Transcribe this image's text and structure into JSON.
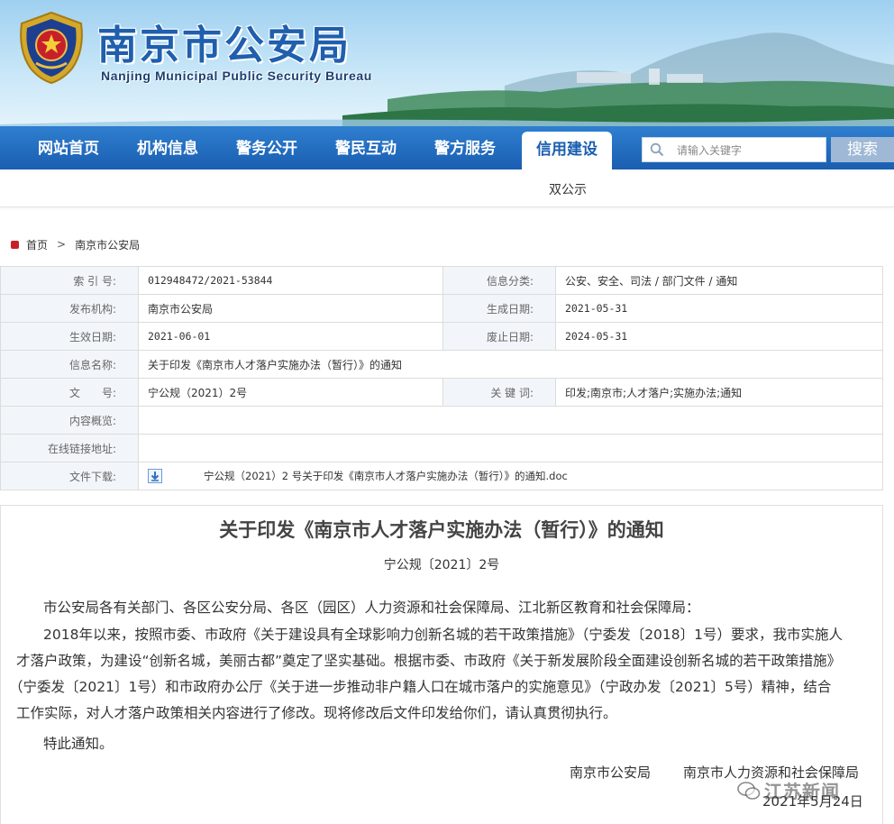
{
  "header": {
    "title": "南京市公安局",
    "subtitle": "Nanjing Municipal Public Security Bureau"
  },
  "nav": {
    "items": [
      {
        "label": "网站首页"
      },
      {
        "label": "机构信息"
      },
      {
        "label": "警务公开"
      },
      {
        "label": "警民互动"
      },
      {
        "label": "警方服务"
      },
      {
        "label": "信用建设",
        "active": true
      }
    ],
    "search": {
      "placeholder": "请输入关键字",
      "button_label": "搜索",
      "icon": "search-icon"
    },
    "sub_items": [
      {
        "label": "双公示"
      }
    ]
  },
  "breadcrumb": {
    "home": "首页",
    "current": "南京市公安局"
  },
  "info": {
    "index_label": "索 引 号:",
    "index_value": "012948472/2021-53844",
    "category_label": "信息分类:",
    "category_value": "公安、安全、司法 / 部门文件 / 通知",
    "publisher_label": "发布机构:",
    "publisher_value": "南京市公安局",
    "created_label": "生成日期:",
    "created_value": "2021-05-31",
    "effective_label": "生效日期:",
    "effective_value": "2021-06-01",
    "expire_label": "废止日期:",
    "expire_value": "2024-05-31",
    "name_label": "信息名称:",
    "name_value": "关于印发《南京市人才落户实施办法（暂行）》的通知",
    "docno_label": "文　　号:",
    "docno_value": "宁公规（2021）2号",
    "keywords_label": "关 键 词:",
    "keywords_value": "印发;南京市;人才落户;实施办法;通知",
    "summary_label": "内容概览:",
    "summary_value": "",
    "link_label": "在线链接地址:",
    "link_value": "",
    "download_label": "文件下载:",
    "download_value": "宁公规（2021）2 号关于印发《南京市人才落户实施办法（暂行）》的通知.doc"
  },
  "article": {
    "title": "关于印发《南京市人才落户实施办法（暂行）》的通知",
    "doc_no": "宁公规〔2021〕2号",
    "salutation": "市公安局各有关部门、各区公安分局、各区（园区）人力资源和社会保障局、江北新区教育和社会保障局：",
    "body_line1": "2018年以来，按照市委、市政府《关于建设具有全球影响力创新名城的若干政策措施》（宁委发〔2018〕1号）要求，我市实施人",
    "body_line2": "才落户政策，为建设“创新名城，美丽古都”奠定了坚实基础。根据市委、市政府《关于新发展阶段全面建设创新名城的若干政策措施》",
    "body_line3": "（宁委发〔2021〕1号）和市政府办公厅《关于进一步推动非户籍人口在城市落户的实施意见》（宁政办发〔2021〕5号）精神，结合",
    "body_line4": "工作实际，对人才落户政策相关内容进行了修改。现将修改后文件印发给你们，请认真贯彻执行。",
    "closing": "特此通知。",
    "signer1": "南京市公安局",
    "signer2": "南京市人力资源和社会保障局",
    "date": "2021年5月24日"
  },
  "watermark": {
    "text": "江苏新闻"
  },
  "colors": {
    "nav_blue": "#1a5eb0",
    "title_blue": "#1f5fae",
    "label_bg": "#f2f6fb",
    "accent_red": "#c8202a"
  }
}
